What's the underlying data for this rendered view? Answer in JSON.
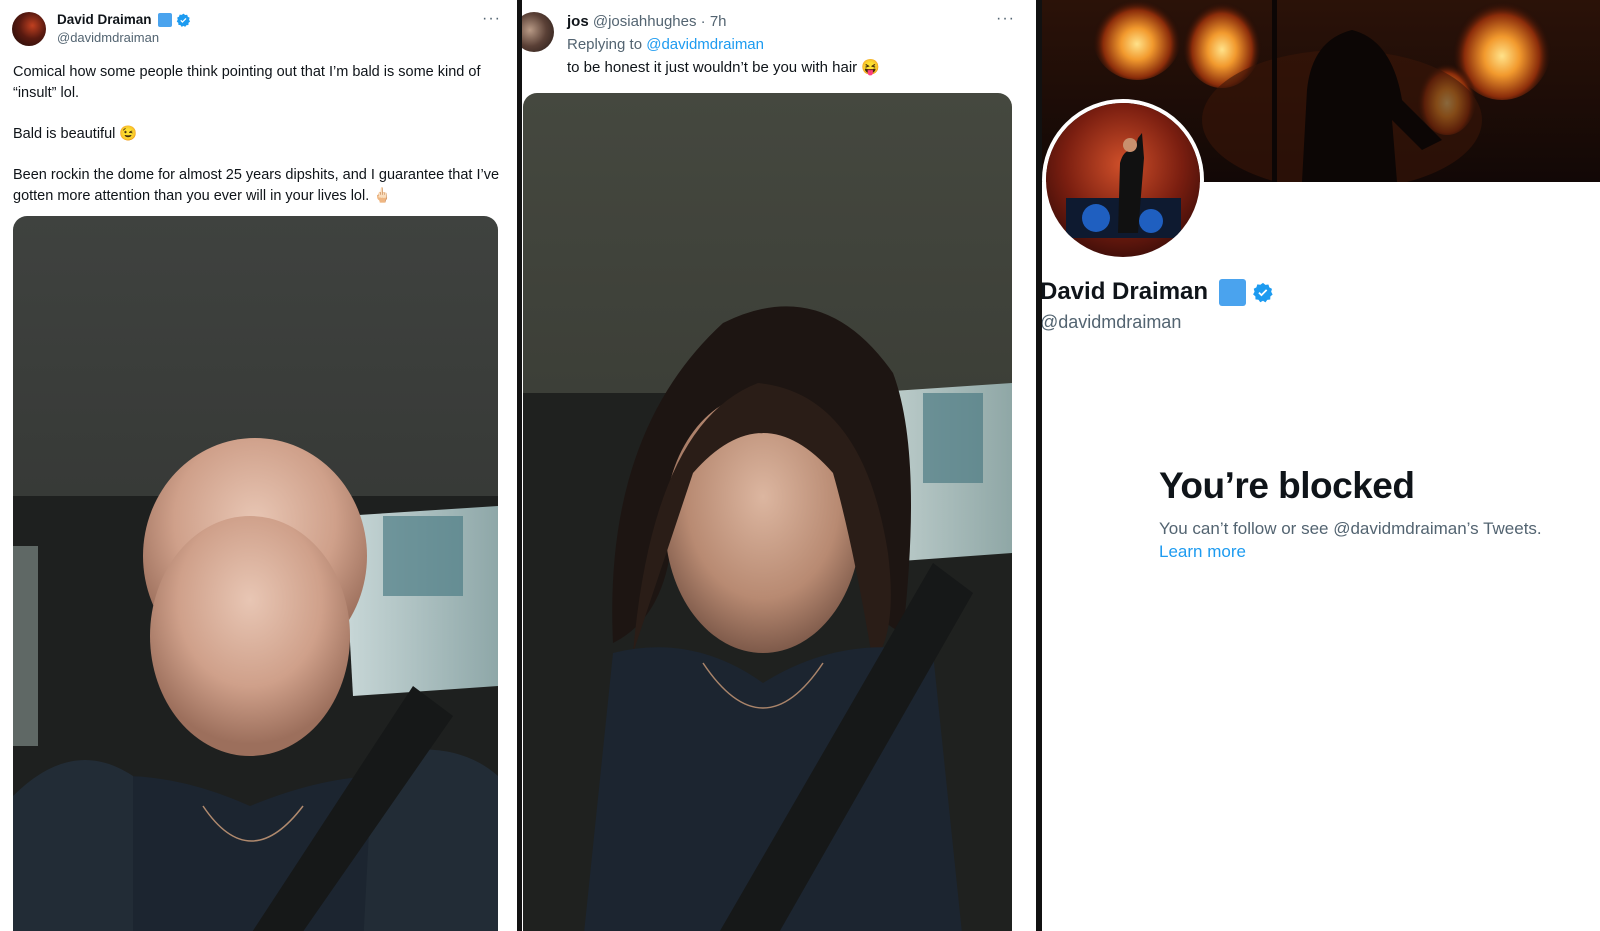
{
  "tweet1": {
    "author_name": "David Draiman",
    "author_handle": "@davidmdraiman",
    "more_label": "···",
    "line1": "Comical how some people think pointing out that I’m bald is some kind of “insult” lol.",
    "line2": "Bald is beautiful 😉",
    "line3": "Been rockin the dome for almost 25 years dipshits, and I guarantee that I’ve gotten more attention than you ever will in your lives lol. 🖕🏻"
  },
  "tweet2": {
    "author_name": "jos",
    "author_handle": "@josiahhughes",
    "separator": "·",
    "time": "7h",
    "replying_label": "Replying to",
    "replying_handle": "@davidmdraiman",
    "text": "to be honest it just wouldn’t be you with hair 😝",
    "more_label": "···"
  },
  "profile": {
    "name": "David Draiman",
    "handle": "@davidmdraiman",
    "blocked_title": "You’re blocked",
    "blocked_text": "You can’t follow or see @davidmdraiman’s Tweets.",
    "learn_more": "Learn more"
  },
  "icons": [
    "verified-badge-icon",
    "more-options-icon"
  ],
  "colors": {
    "link": "#1d9bf0",
    "verified": "#1d9bf0",
    "badge_square": "#4aa3ee"
  }
}
